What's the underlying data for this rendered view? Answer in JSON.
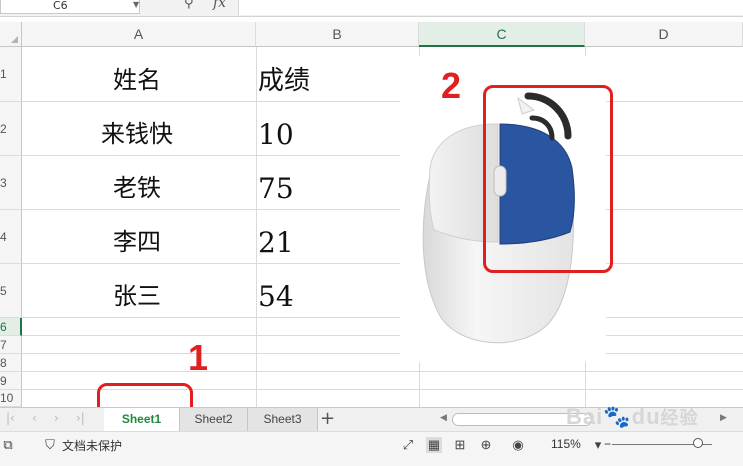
{
  "formula_bar": {
    "cell_ref": "C6",
    "fx_label": "fx",
    "content": ""
  },
  "columns": [
    {
      "id": "A",
      "label": "A"
    },
    {
      "id": "B",
      "label": "B"
    },
    {
      "id": "C",
      "label": "C"
    },
    {
      "id": "D",
      "label": "D"
    }
  ],
  "rows": [
    "1",
    "2",
    "3",
    "4",
    "5",
    "6",
    "7",
    "8",
    "9",
    "10"
  ],
  "selected_cell": "C6",
  "table": {
    "header": {
      "name": "姓名",
      "score": "成绩"
    },
    "records": [
      {
        "name": "来钱快",
        "score": "10"
      },
      {
        "name": "老铁",
        "score": "75"
      },
      {
        "name": "李四",
        "score": "21"
      },
      {
        "name": "张三",
        "score": "54"
      }
    ]
  },
  "annotations": {
    "label1": "1",
    "label2": "2",
    "color": "#e02020"
  },
  "mouse_illustration": {
    "highlight": "right-button",
    "highlight_color": "#2a55a0"
  },
  "sheet_tabs": [
    {
      "label": "Sheet1",
      "active": true
    },
    {
      "label": "Sheet2",
      "active": false
    },
    {
      "label": "Sheet3",
      "active": false
    }
  ],
  "status_bar": {
    "protection_text": "文档未保护",
    "zoom_level": "115%",
    "zoom_minus": "−"
  },
  "watermark": {
    "text_latin": "Bai",
    "text_paw": "🐾",
    "text_du": "du",
    "text_cn": "经验"
  },
  "colors": {
    "accent_green": "#217346",
    "tab_green": "#1e8a3a"
  }
}
